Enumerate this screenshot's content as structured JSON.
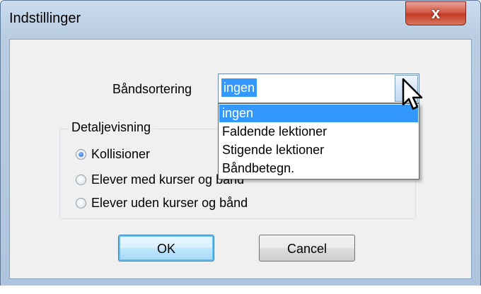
{
  "window": {
    "title": "Indstillinger",
    "close_label": "x"
  },
  "band_sort": {
    "label": "Båndsortering",
    "selected": "ingen",
    "options": [
      "ingen",
      "Faldende lektioner",
      "Stigende lektioner",
      "Båndbetegn."
    ],
    "highlighted_index": 0
  },
  "detail": {
    "group_label": "Detaljevisning",
    "options": [
      {
        "label": "Kollisioner",
        "checked": true
      },
      {
        "label": "Elever med kurser og bånd",
        "checked": false
      },
      {
        "label": "Elever uden kurser og bånd",
        "checked": false
      }
    ]
  },
  "buttons": {
    "ok": "OK",
    "cancel": "Cancel"
  },
  "colors": {
    "selection": "#3399ff",
    "close_button": "#c8442c",
    "titlebar": "#b9cde3"
  },
  "icons": {
    "close": "close-icon",
    "dropdown": "chevron-down-icon",
    "cursor": "mouse-pointer-icon"
  }
}
